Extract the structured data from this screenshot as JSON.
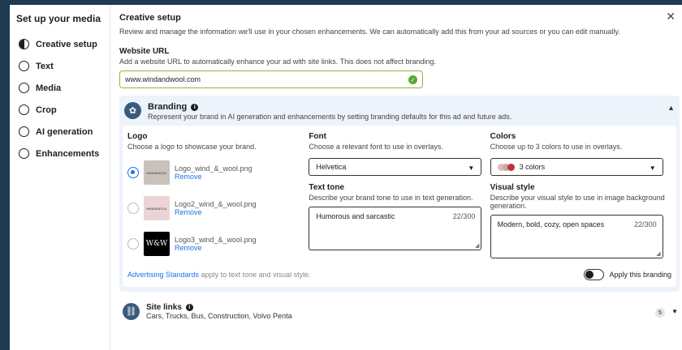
{
  "sidebar": {
    "title": "Set up your media",
    "steps": [
      {
        "label": "Creative setup"
      },
      {
        "label": "Text"
      },
      {
        "label": "Media"
      },
      {
        "label": "Crop"
      },
      {
        "label": "AI generation"
      },
      {
        "label": "Enhancements"
      }
    ]
  },
  "header": {
    "title": "Creative setup",
    "description": "Review and manage the information we'll use in your chosen enhancements. We can automatically add this from your ad sources or you can edit manually.",
    "close_glyph": "✕"
  },
  "website": {
    "label": "Website URL",
    "description": "Add a website URL to automatically enhance your ad with site links. This does not affect branding.",
    "value": "www.windandwool.com"
  },
  "branding": {
    "title": "Branding",
    "description": "Represent your brand in AI generation and enhancements by setting branding defaults for this ad and future ads.",
    "logo": {
      "label": "Logo",
      "description": "Choose a logo to showcase your brand.",
      "remove_label": "Remove",
      "items": [
        {
          "file": "Logo_wind_&_wool.png",
          "thumb": "WIND&WOOL",
          "selected": true
        },
        {
          "file": "Logo2_wind_&_wool.png",
          "thumb": "WIND&WOOL",
          "selected": false
        },
        {
          "file": "Logo3_wind_&_wool.png",
          "thumb": "W&W",
          "selected": false
        }
      ]
    },
    "font": {
      "label": "Font",
      "description": "Choose a relevant font to use in overlays.",
      "value": "Helvetica"
    },
    "colors": {
      "label": "Colors",
      "description": "Choose up to 3 colors to use in overlays.",
      "value": "3 colors",
      "swatches": [
        "#e9b8bb",
        "#c5a8a8",
        "#c1323b"
      ]
    },
    "text_tone": {
      "label": "Text tone",
      "description": "Describe your brand tone to use in text generation.",
      "value": "Humorous and sarcastic",
      "count": "22/300"
    },
    "visual_style": {
      "label": "Visual style",
      "description": "Describe your visual style to use in image background generation.",
      "value": "Modern, bold, cozy, open spaces",
      "count": "22/300"
    },
    "footer": {
      "link": "Advertising Standards",
      "rest": " apply to text tone and visual style.",
      "toggle_label": "Apply this branding"
    }
  },
  "site_links": {
    "title": "Site links",
    "items": "Cars, Trucks, Bus, Construction, Volvo Penta",
    "count": "5"
  }
}
